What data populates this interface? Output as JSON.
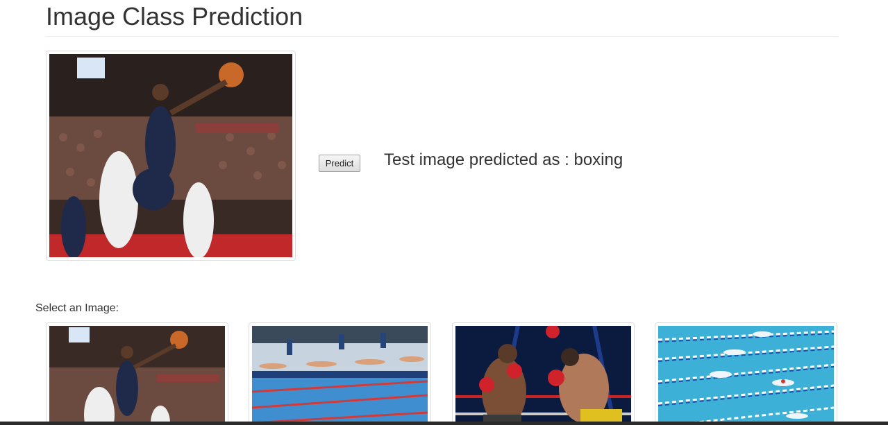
{
  "header": {
    "title": "Image Class Prediction"
  },
  "preview": {
    "image_subject": "basketball"
  },
  "predict_button": {
    "label": "Predict"
  },
  "prediction": {
    "text": "Test image predicted as : boxing"
  },
  "gallery": {
    "label": "Select an Image:",
    "items": [
      {
        "subject": "basketball"
      },
      {
        "subject": "swimming-dive"
      },
      {
        "subject": "boxing"
      },
      {
        "subject": "swimming-pool"
      }
    ]
  }
}
